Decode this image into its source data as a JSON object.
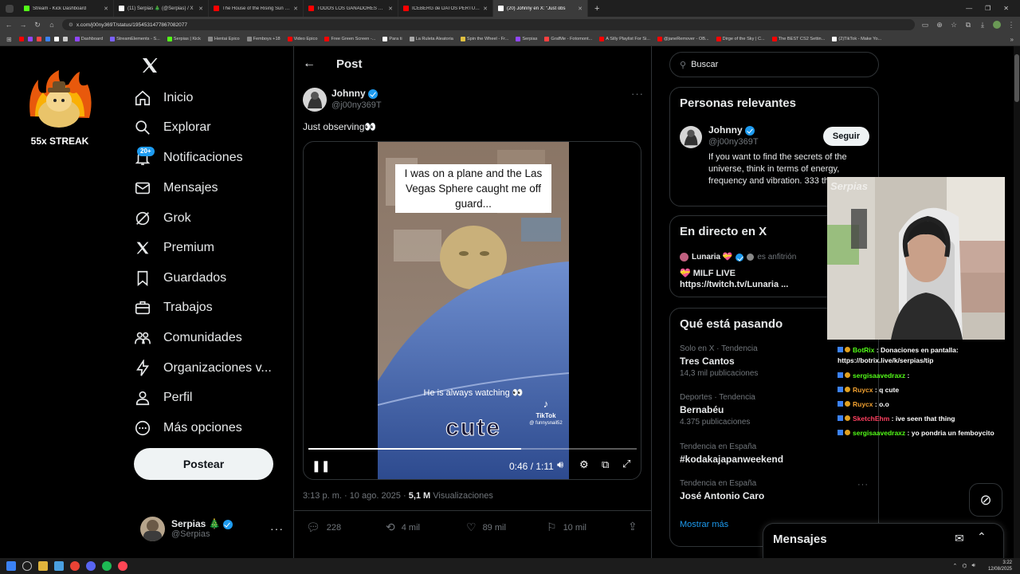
{
  "browser": {
    "tabs": [
      {
        "label": "Stream - Kick Dashboard",
        "color": "#53fc18",
        "active": false
      },
      {
        "label": "(11) Serpias 🎄 (@Serpias) / X",
        "color": "#ffffff",
        "active": false
      },
      {
        "label": "The House of the Rising Sun (re",
        "color": "#ff0000",
        "active": false
      },
      {
        "label": "TODOS LOS GANADORES DE H",
        "color": "#ff0000",
        "active": false
      },
      {
        "label": "ICEBERG de DATOS PERTURBA",
        "color": "#ff0000",
        "active": false
      },
      {
        "label": "(20) Johnny en X: \"Just obs",
        "color": "#ffffff",
        "active": true
      }
    ],
    "url": "x.com/j00ny369T/status/1954531477867082077",
    "bookmarks": [
      {
        "label": "Dashboard",
        "color": "#9146ff"
      },
      {
        "label": "StreamElements - S...",
        "color": "#7b61ff"
      },
      {
        "label": "Serpias | Kick",
        "color": "#53fc18"
      },
      {
        "label": "Hentai Epico",
        "color": "#888888"
      },
      {
        "label": "Femboys +18",
        "color": "#888888"
      },
      {
        "label": "Video Epico",
        "color": "#ff0000"
      },
      {
        "label": "Free Green Screen -...",
        "color": "#ff0000"
      },
      {
        "label": "Para ti",
        "color": "#ffffff"
      },
      {
        "label": "La Ruleta Aleatoria",
        "color": "#aaaaaa"
      },
      {
        "label": "Spin the Wheel - Fr...",
        "color": "#e0c040"
      },
      {
        "label": "Serpias",
        "color": "#9146ff"
      },
      {
        "label": "GrafMe - Fotomont...",
        "color": "#ff4040"
      },
      {
        "label": "A Silly Playlist For Si...",
        "color": "#ff0000"
      },
      {
        "label": "@janeRemover - OB...",
        "color": "#ff0000"
      },
      {
        "label": "Dirge of the Sky | C...",
        "color": "#ff0000"
      },
      {
        "label": "The BEST CS2 Settin...",
        "color": "#ff0000"
      },
      {
        "label": "(2)TikTok - Make Yo...",
        "color": "#ffffff"
      }
    ]
  },
  "overlay": {
    "streak_label": "55x STREAK"
  },
  "nav": {
    "items": [
      {
        "label": "Inicio",
        "icon": "home-icon"
      },
      {
        "label": "Explorar",
        "icon": "search-icon"
      },
      {
        "label": "Notificaciones",
        "icon": "bell-icon"
      },
      {
        "label": "Mensajes",
        "icon": "mail-icon"
      },
      {
        "label": "Grok",
        "icon": "grok-icon"
      },
      {
        "label": "Premium",
        "icon": "x-logo-icon"
      },
      {
        "label": "Guardados",
        "icon": "bookmark-icon"
      },
      {
        "label": "Trabajos",
        "icon": "briefcase-icon"
      },
      {
        "label": "Comunidades",
        "icon": "people-icon"
      },
      {
        "label": "Organizaciones v...",
        "icon": "lightning-icon"
      },
      {
        "label": "Perfil",
        "icon": "person-icon"
      },
      {
        "label": "Más opciones",
        "icon": "more-circle-icon"
      }
    ],
    "notif_badge": "20+",
    "post_button": "Postear",
    "account": {
      "name": "Serpias 🎄",
      "handle": "@Serpias"
    }
  },
  "post": {
    "header": "Post",
    "author_name": "Johnny",
    "author_handle": "@j00ny369T",
    "text": "Just observing👀",
    "video": {
      "caption_top": "I was on a plane and the Las Vegas Sphere caught me off guard...",
      "caption_bottom": "He is always watching 👀",
      "caption_big": "cute",
      "tiktok_label": "TikTok",
      "tiktok_handle": "@ funnysnail52",
      "time": "0:46 / 1:11",
      "progress": 0.648
    },
    "timestamp": "3:13 p. m. · 10 ago. 2025 ·",
    "views_count": "5,1 M",
    "views_label": "Visualizaciones",
    "stats": {
      "replies": "228",
      "reposts": "4 mil",
      "likes": "89 mil",
      "bookmarks": "10 mil"
    }
  },
  "sidebar": {
    "search_placeholder": "Buscar",
    "relevant": {
      "title": "Personas relevantes",
      "name": "Johnny",
      "handle": "@j00ny369T",
      "follow_label": "Seguir",
      "bio": "If you want to find the secrets of the universe, think in terms of energy, frequency and vibration. 333 the Narrative"
    },
    "live": {
      "title": "En directo en X",
      "host_name": "Lunaria 💝",
      "host_role": "es anfitrión",
      "stream_title": "💝 MILF LIVE",
      "stream_link": "https://twitch.tv/Lunaria ..."
    },
    "trends": {
      "title": "Qué está pasando",
      "items": [
        {
          "meta": "Solo en X · Tendencia",
          "name": "Tres Cantos",
          "count": "14,3 mil publicaciones"
        },
        {
          "meta": "Deportes · Tendencia",
          "name": "Bernabéu",
          "count": "4.375 publicaciones"
        },
        {
          "meta": "Tendencia en España",
          "name": "#kodakajapanweekend",
          "count": ""
        },
        {
          "meta": "Tendencia en España",
          "name": "José Antonio Caro",
          "count": ""
        }
      ],
      "show_more": "Mostrar más"
    },
    "messages_title": "Mensajes"
  },
  "chat": {
    "watermark": "Serpias",
    "lines": [
      {
        "user": "BotRix",
        "color": "#53fc18",
        "text": ": Donaciones en pantalla: https://botrix.live/k/serpias/tip"
      },
      {
        "user": "sergisaavedraxz",
        "color": "#53fc18",
        "text": ":"
      },
      {
        "user": "Ruycx",
        "color": "#f0a030",
        "text": ": q cute"
      },
      {
        "user": "Ruycx",
        "color": "#f0a030",
        "text": ": o.o"
      },
      {
        "user": "SketchEhm",
        "color": "#ff4060",
        "text": ": ive seen that thing"
      },
      {
        "user": "sergisaavedraxz",
        "color": "#53fc18",
        "text": ": yo pondria un femboycito"
      }
    ]
  },
  "taskbar": {
    "time": "3:22",
    "date": "12/08/2025"
  }
}
